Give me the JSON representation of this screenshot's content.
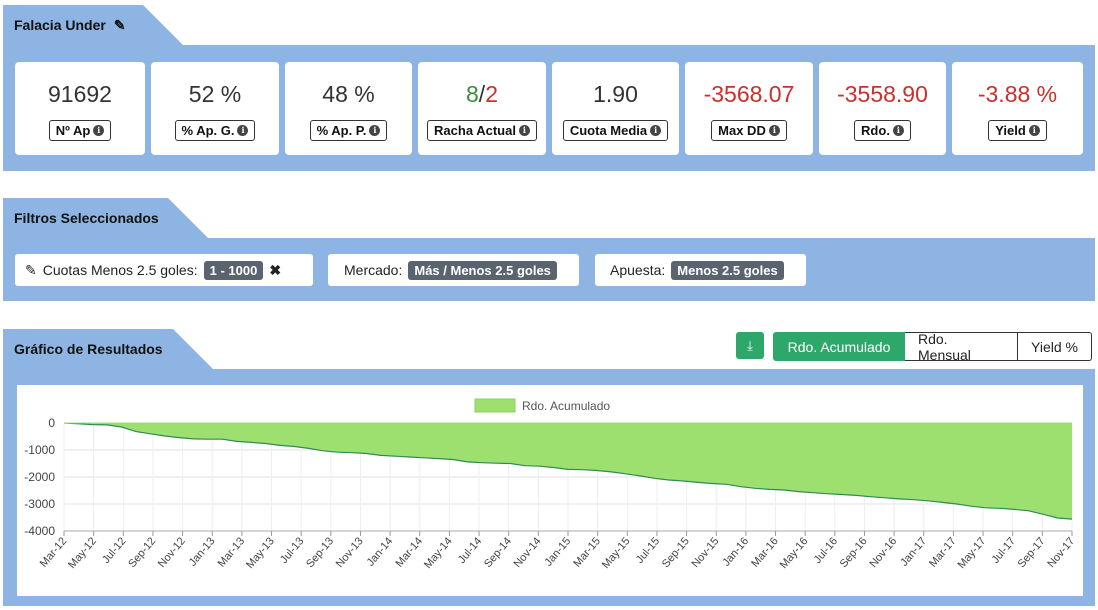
{
  "summary": {
    "title": "Falacia Under",
    "stats": [
      {
        "value": "91692",
        "label": "Nº Ap"
      },
      {
        "value": "52 %",
        "label": "% Ap. G."
      },
      {
        "value": "48 %",
        "label": "% Ap. P."
      },
      {
        "value_win": "8",
        "value_sep": "/",
        "value_loss": "2",
        "label": "Racha Actual"
      },
      {
        "value": "1.90",
        "label": "Cuota Media"
      },
      {
        "value": "-3568.07",
        "label": "Max DD"
      },
      {
        "value": "-3558.90",
        "label": "Rdo."
      },
      {
        "value": "-3.88 %",
        "label": "Yield"
      }
    ]
  },
  "filters": {
    "title": "Filtros Seleccionados",
    "items": [
      {
        "label": "Cuotas Menos 2.5 goles:",
        "value": "1 - 1000"
      },
      {
        "label": "Mercado:",
        "value": "Más / Menos 2.5 goles"
      },
      {
        "label": "Apuesta:",
        "value": "Menos 2.5 goles"
      }
    ]
  },
  "results": {
    "title": "Gráfico de Resultados",
    "buttons": [
      "Rdo. Acumulado",
      "Rdo. Mensual",
      "Yield %"
    ],
    "active_button": "Rdo. Acumulado"
  },
  "colors": {
    "band": "#8db4e2",
    "positive": "#3c8d3c",
    "negative": "#c9302c",
    "accent": "#2ea76a",
    "area_fill": "#9de070",
    "area_line": "#2e8b57"
  },
  "chart_data": {
    "type": "area",
    "legend": "Rdo. Acumulado",
    "legend_position": "top-center",
    "grid": true,
    "ylim": [
      -4000,
      0
    ],
    "yticks": [
      0,
      -1000,
      -2000,
      -3000,
      -4000
    ],
    "x_labels": [
      "Mar-12",
      "May-12",
      "Jul-12",
      "Sep-12",
      "Nov-12",
      "Jan-13",
      "Mar-13",
      "May-13",
      "Jul-13",
      "Sep-13",
      "Nov-13",
      "Jan-14",
      "Mar-14",
      "May-14",
      "Jul-14",
      "Sep-14",
      "Nov-14",
      "Jan-15",
      "Mar-15",
      "May-15",
      "Jul-15",
      "Sep-15",
      "Nov-15",
      "Jan-16",
      "Mar-16",
      "May-16",
      "Jul-16",
      "Sep-16",
      "Nov-16",
      "Jan-17",
      "Mar-17",
      "May-17",
      "Jul-17",
      "Sep-17",
      "Nov-17"
    ],
    "series": [
      {
        "name": "Rdo. Acumulado",
        "values": [
          0,
          -30,
          -60,
          -70,
          -150,
          -320,
          -400,
          -480,
          -540,
          -590,
          -600,
          -600,
          -680,
          -720,
          -760,
          -830,
          -870,
          -940,
          -1030,
          -1080,
          -1100,
          -1130,
          -1200,
          -1230,
          -1260,
          -1290,
          -1320,
          -1350,
          -1440,
          -1470,
          -1490,
          -1500,
          -1580,
          -1600,
          -1650,
          -1720,
          -1730,
          -1760,
          -1810,
          -1880,
          -1960,
          -2050,
          -2110,
          -2150,
          -2200,
          -2240,
          -2270,
          -2360,
          -2420,
          -2460,
          -2480,
          -2540,
          -2580,
          -2620,
          -2650,
          -2680,
          -2730,
          -2770,
          -2810,
          -2840,
          -2880,
          -2940,
          -3000,
          -3080,
          -3140,
          -3160,
          -3200,
          -3250,
          -3380,
          -3520,
          -3560
        ]
      }
    ]
  }
}
